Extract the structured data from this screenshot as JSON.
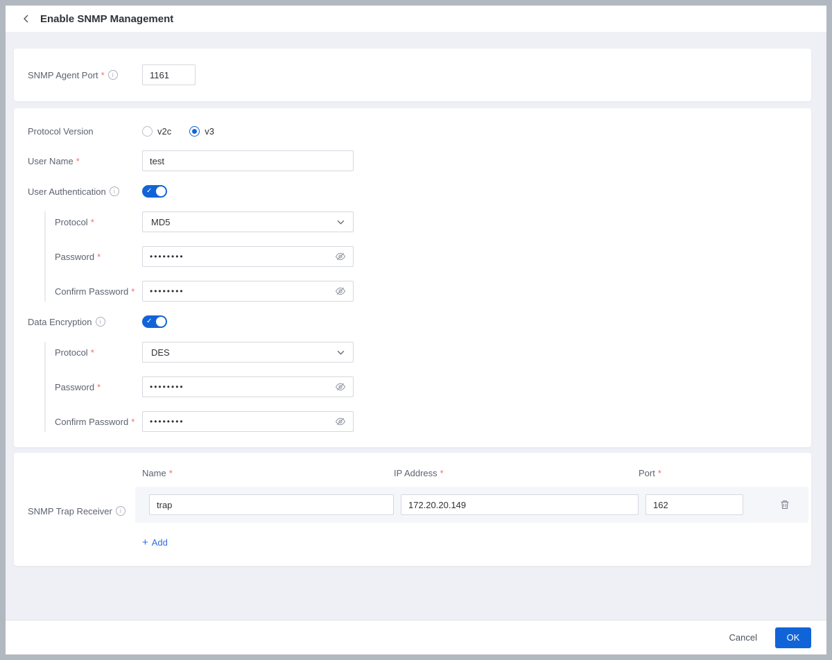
{
  "header": {
    "title": "Enable SNMP Management"
  },
  "misc": {
    "required_mark": "*",
    "info_mark": "i",
    "plus_mark": "+"
  },
  "agent_port": {
    "label": "SNMP Agent Port",
    "value": "1161"
  },
  "protocol_version": {
    "label": "Protocol Version",
    "options": [
      {
        "label": "v2c",
        "selected": false
      },
      {
        "label": "v3",
        "selected": true
      }
    ]
  },
  "user_name": {
    "label": "User Name",
    "value": "test"
  },
  "user_auth": {
    "label": "User Authentication",
    "enabled": true,
    "protocol": {
      "label": "Protocol",
      "value": "MD5"
    },
    "password": {
      "label": "Password",
      "masked_value": "••••••••"
    },
    "confirm_password": {
      "label": "Confirm Password",
      "masked_value": "••••••••"
    }
  },
  "data_encryption": {
    "label": "Data Encryption",
    "enabled": true,
    "protocol": {
      "label": "Protocol",
      "value": "DES"
    },
    "password": {
      "label": "Password",
      "masked_value": "••••••••"
    },
    "confirm_password": {
      "label": "Confirm Password",
      "masked_value": "••••••••"
    }
  },
  "trap": {
    "label": "SNMP Trap Receiver",
    "headers": {
      "name": "Name",
      "ip": "IP Address",
      "port": "Port"
    },
    "rows": [
      {
        "name": "trap",
        "ip": "172.20.20.149",
        "port": "162"
      }
    ],
    "add_label": "Add"
  },
  "footer": {
    "cancel_label": "Cancel",
    "ok_label": "OK"
  },
  "colors": {
    "primary": "#1164d8",
    "link": "#2e6be6",
    "required": "#f56c6c",
    "row_bg": "#f5f6fa"
  }
}
